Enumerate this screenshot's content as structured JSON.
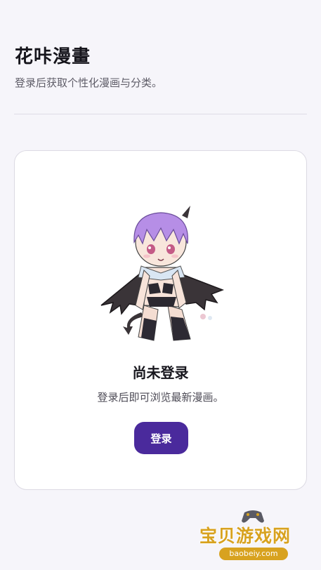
{
  "header": {
    "title": "花咔漫畫",
    "subtitle": "登录后获取个性化漫画与分类。"
  },
  "empty_state": {
    "illustration_icon": "chibi-character-illustration",
    "title": "尚未登录",
    "description": "登录后即可浏览最新漫画。",
    "login_label": "登录"
  },
  "watermark": {
    "text": "宝贝游戏网",
    "url": "baobeiy.com",
    "icon": "gamepad-icon"
  },
  "colors": {
    "background": "#f6f5fa",
    "accent": "#4a2a9c",
    "card": "#ffffff",
    "watermark": "#d8a21f"
  }
}
